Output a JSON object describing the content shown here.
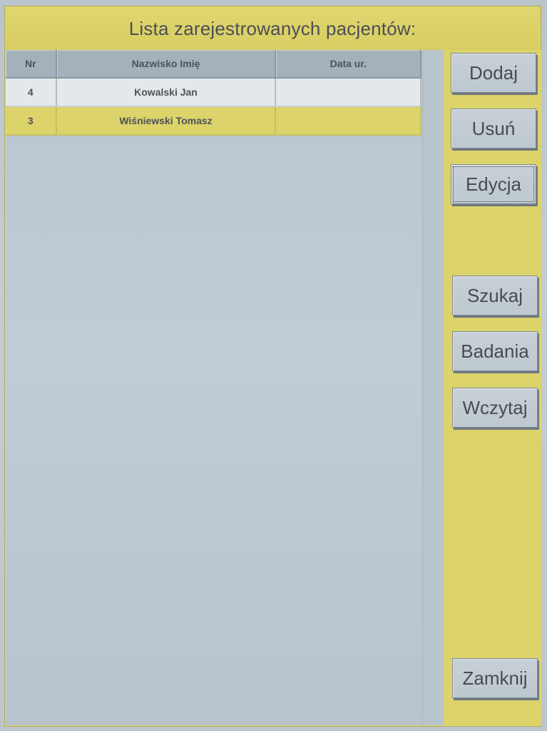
{
  "title": "Lista zarejestrowanych pacjentów:",
  "table": {
    "headers": {
      "nr": "Nr",
      "name": "Nazwisko Imię",
      "dob": "Data ur."
    },
    "rows": [
      {
        "nr": "4",
        "name": "Kowalski Jan",
        "dob": ""
      },
      {
        "nr": "3",
        "name": "Wiśniewski Tomasz",
        "dob": ""
      }
    ]
  },
  "buttons": {
    "add": "Dodaj",
    "remove": "Usuń",
    "edit": "Edycja",
    "search": "Szukaj",
    "exams": "Badania",
    "load": "Wczytaj",
    "close": "Zamknij"
  },
  "colors": {
    "accent_yellow": "#dcd36a",
    "panel_gray": "#bfc9d1",
    "header_gray": "#a4b0ba"
  }
}
